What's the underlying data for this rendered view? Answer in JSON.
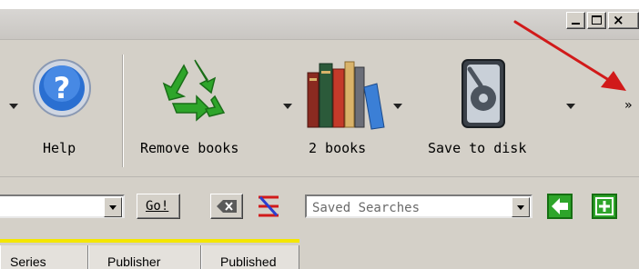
{
  "window": {
    "controls": {
      "minimize": "minimize",
      "maximize": "maximize",
      "close": "×"
    }
  },
  "toolbar": {
    "overflow_label": "»",
    "buttons": [
      {
        "id": "help",
        "label": "Help",
        "icon": "help-question-icon"
      },
      {
        "id": "remove-books",
        "label": "Remove books",
        "icon": "recycle-icon"
      },
      {
        "id": "library",
        "label": "2 books",
        "icon": "books-icon"
      },
      {
        "id": "save-to-disk",
        "label": "Save to disk",
        "icon": "disk-icon"
      }
    ]
  },
  "search": {
    "input_value": "",
    "go_label": "Go!",
    "saved_searches_placeholder": "Saved Searches"
  },
  "columns": [
    "Series",
    "Publisher",
    "Published"
  ],
  "colors": {
    "help_blue": "#2a6fd1",
    "recycle_green": "#2ea52a",
    "arrow_red": "#d11a1a",
    "highlight_yellow": "#f4e600"
  }
}
